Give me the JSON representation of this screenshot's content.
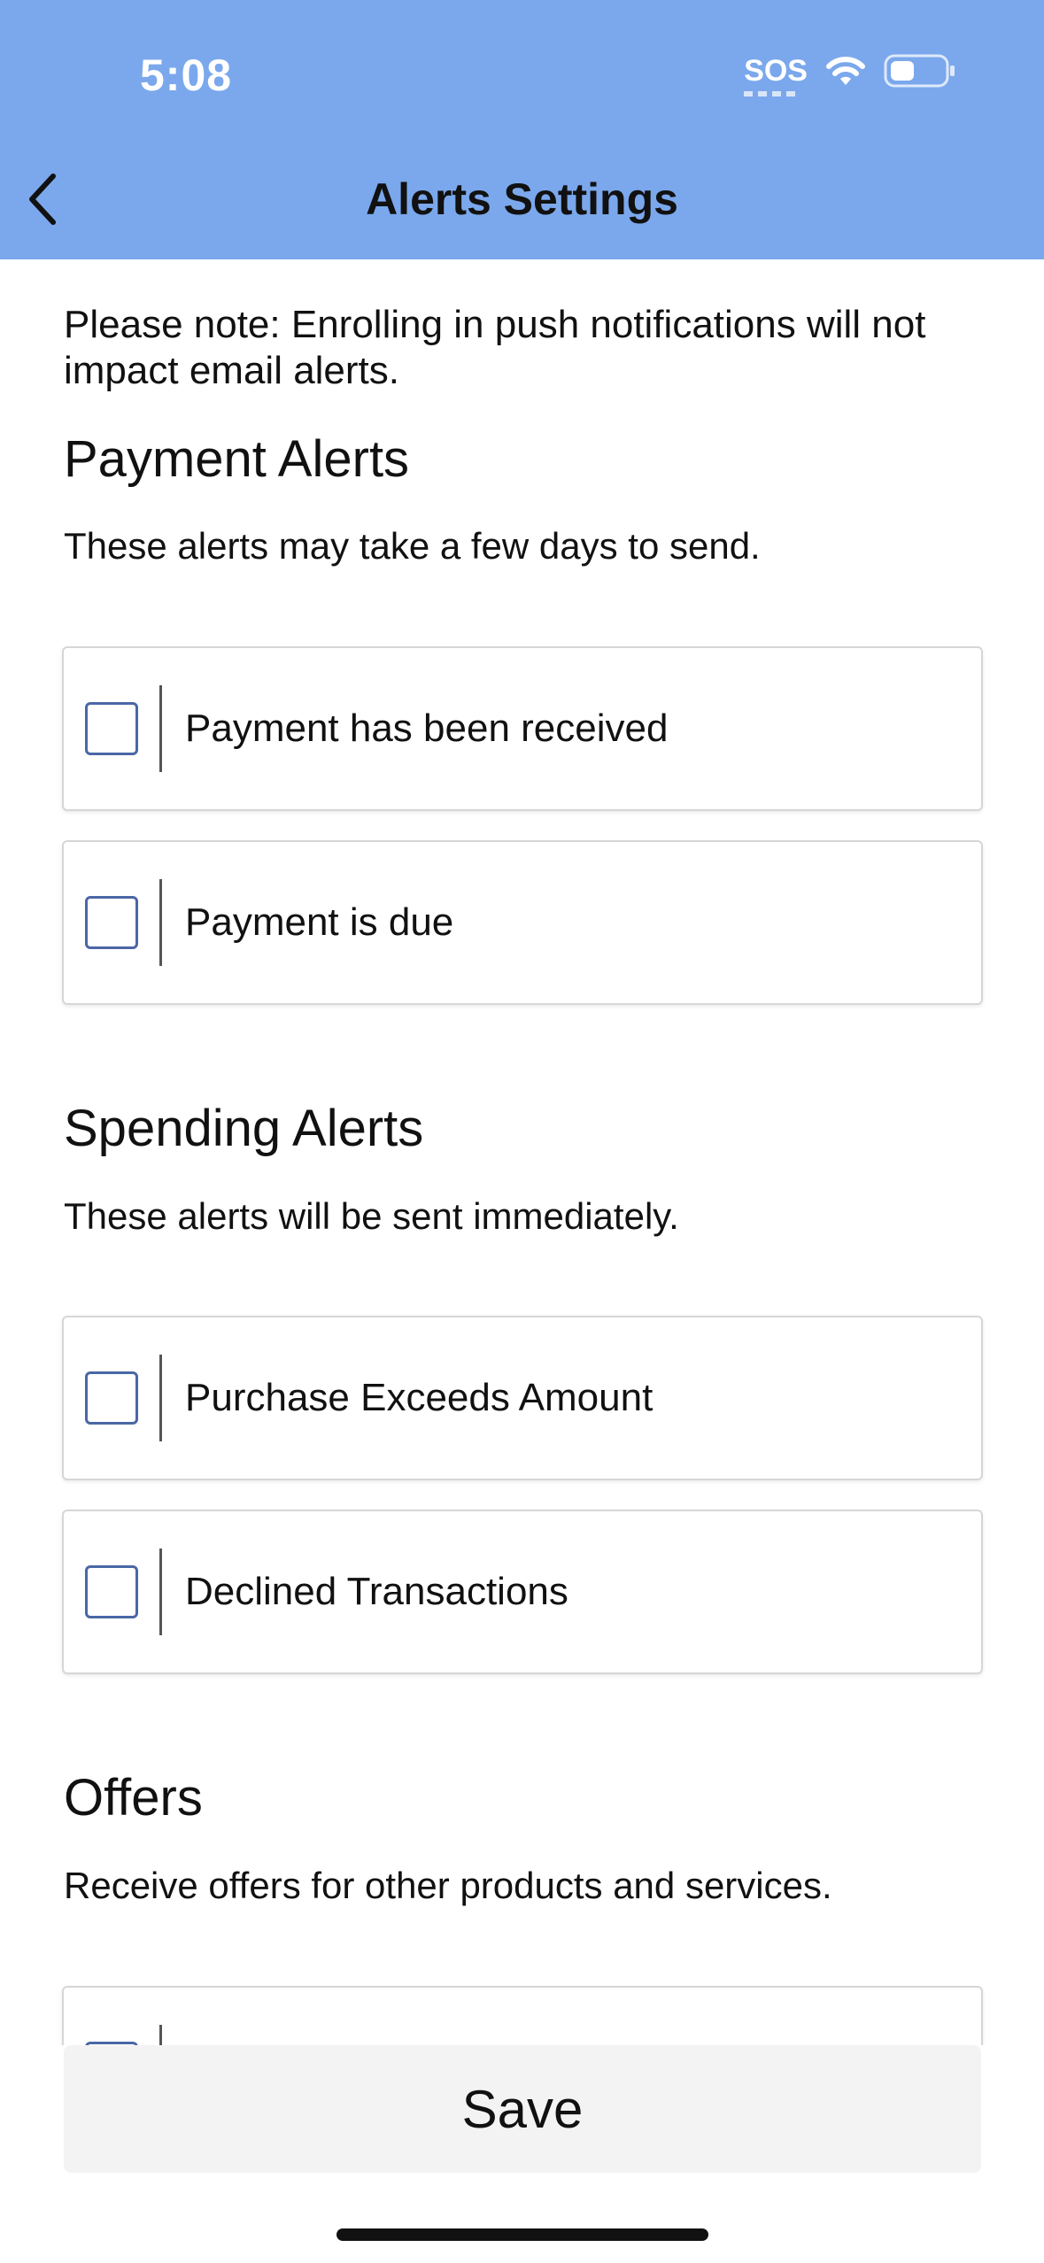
{
  "status_bar": {
    "time": "5:08",
    "sos": "SOS",
    "icons": [
      "wifi-icon",
      "battery-icon"
    ]
  },
  "nav": {
    "title": "Alerts Settings",
    "back_icon": "chevron-left-icon"
  },
  "note": "Please note: Enrolling in push notifications will not impact email alerts.",
  "sections": [
    {
      "title": "Payment Alerts",
      "description": "These alerts may take a few days to send.",
      "options": [
        {
          "label": "Payment has been received",
          "checked": false
        },
        {
          "label": "Payment is due",
          "checked": false
        }
      ]
    },
    {
      "title": "Spending Alerts",
      "description": "These alerts will be sent immediately.",
      "options": [
        {
          "label": "Purchase Exceeds Amount",
          "checked": false
        },
        {
          "label": "Declined Transactions",
          "checked": false
        }
      ]
    },
    {
      "title": "Offers",
      "description": "Receive offers for other products and services.",
      "options": [
        {
          "label": "",
          "checked": false
        }
      ]
    }
  ],
  "save_label": "Save",
  "colors": {
    "header_bg": "#7ba8ec",
    "checkbox_border": "#4a67a6",
    "save_bg": "#f3f3f3"
  }
}
